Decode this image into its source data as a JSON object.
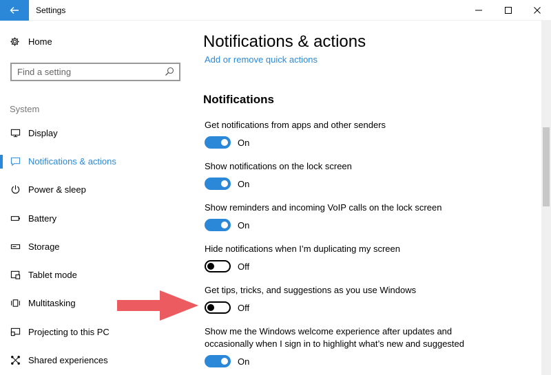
{
  "window": {
    "title": "Settings"
  },
  "sidebar": {
    "home_label": "Home",
    "search_placeholder": "Find a setting",
    "section_label": "System",
    "items": [
      {
        "label": "Display",
        "icon": "monitor-icon"
      },
      {
        "label": "Notifications & actions",
        "icon": "notification-icon",
        "active": true
      },
      {
        "label": "Power & sleep",
        "icon": "power-icon"
      },
      {
        "label": "Battery",
        "icon": "battery-icon"
      },
      {
        "label": "Storage",
        "icon": "storage-icon"
      },
      {
        "label": "Tablet mode",
        "icon": "tablet-icon"
      },
      {
        "label": "Multitasking",
        "icon": "multitasking-icon"
      },
      {
        "label": "Projecting to this PC",
        "icon": "projecting-icon"
      },
      {
        "label": "Shared experiences",
        "icon": "shared-icon"
      }
    ]
  },
  "main": {
    "title": "Notifications & actions",
    "quick_link": "Add or remove quick actions",
    "heading": "Notifications",
    "settings": [
      {
        "label": "Get notifications from apps and other senders",
        "state": "On"
      },
      {
        "label": "Show notifications on the lock screen",
        "state": "On"
      },
      {
        "label": "Show reminders and incoming VoIP calls on the lock screen",
        "state": "On"
      },
      {
        "label": "Hide notifications when I’m duplicating my screen",
        "state": "Off"
      },
      {
        "label": "Get tips, tricks, and suggestions as you use Windows",
        "state": "Off"
      },
      {
        "label": "Show me the Windows welcome experience after updates and occasionally when I sign in to highlight what’s new and suggested",
        "state": "On"
      }
    ]
  },
  "colors": {
    "accent": "#2b88d8",
    "annotation_arrow": "#ec5b5f"
  }
}
